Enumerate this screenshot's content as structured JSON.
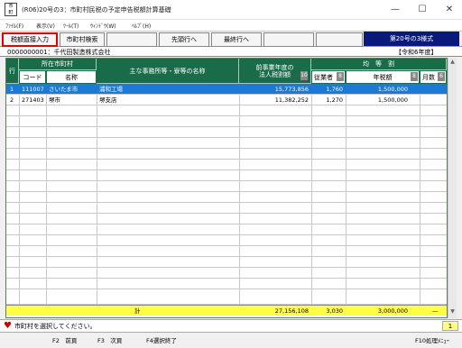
{
  "window": {
    "title": "(R06)20号の3：市町村民税の予定申告税額計算基礎",
    "icon_text": "市\n町\n村",
    "minimize": "—",
    "maximize": "☐",
    "close": "✕"
  },
  "menu": [
    "ﾌｧｲﾙ(F)",
    "表示(V)",
    "ﾂｰﾙ(T)",
    "ｳｨﾝﾄﾞｳ(W)",
    "ﾍﾙﾌﾟ(H)"
  ],
  "toolbar": {
    "direct_input": "税額直接入力",
    "city_search": "市町村検索",
    "first_row": "先頭行へ",
    "last_row": "最終行へ",
    "form_label": "第20号の3様式"
  },
  "company": {
    "code_name": "0000000001：千代田製造株式会社",
    "era": "【令和6年度】"
  },
  "grid": {
    "headers": {
      "row_no": "行",
      "location": "所在市町村",
      "code": "コード",
      "name": "名称",
      "office": "主な事務所等・寮等の名称",
      "prev_tax_line1": "前事業年度の",
      "prev_tax_line2": "法人税割額",
      "prev_tax_badge": "10",
      "equal": "均　等　割",
      "employees": "従業者",
      "employees_badge": "8",
      "annual_tax": "年税額",
      "annual_badge": "8",
      "months": "月数",
      "months_badge": "6"
    },
    "rows": [
      {
        "no": "1",
        "code": "111007",
        "city": "さいたま市",
        "office": "浦和工場",
        "prev_tax": "15,773,856",
        "employees": "1,760",
        "annual_tax": "1,500,000",
        "months": ""
      },
      {
        "no": "2",
        "code": "271403",
        "city": "堺市",
        "office": "堺支店",
        "prev_tax": "11,382,252",
        "employees": "1,270",
        "annual_tax": "1,500,000",
        "months": ""
      }
    ],
    "total": {
      "label": "計",
      "prev_tax": "27,156,108",
      "employees": "3,030",
      "annual_tax": "3,000,000",
      "months": "—"
    }
  },
  "status": {
    "message": "市町村を選択してください。",
    "right_value": "1"
  },
  "fkeys": [
    "F2　前頁",
    "F3　次頁",
    "F4選択終了",
    "F10処理ﾒﾆｭｰ"
  ]
}
